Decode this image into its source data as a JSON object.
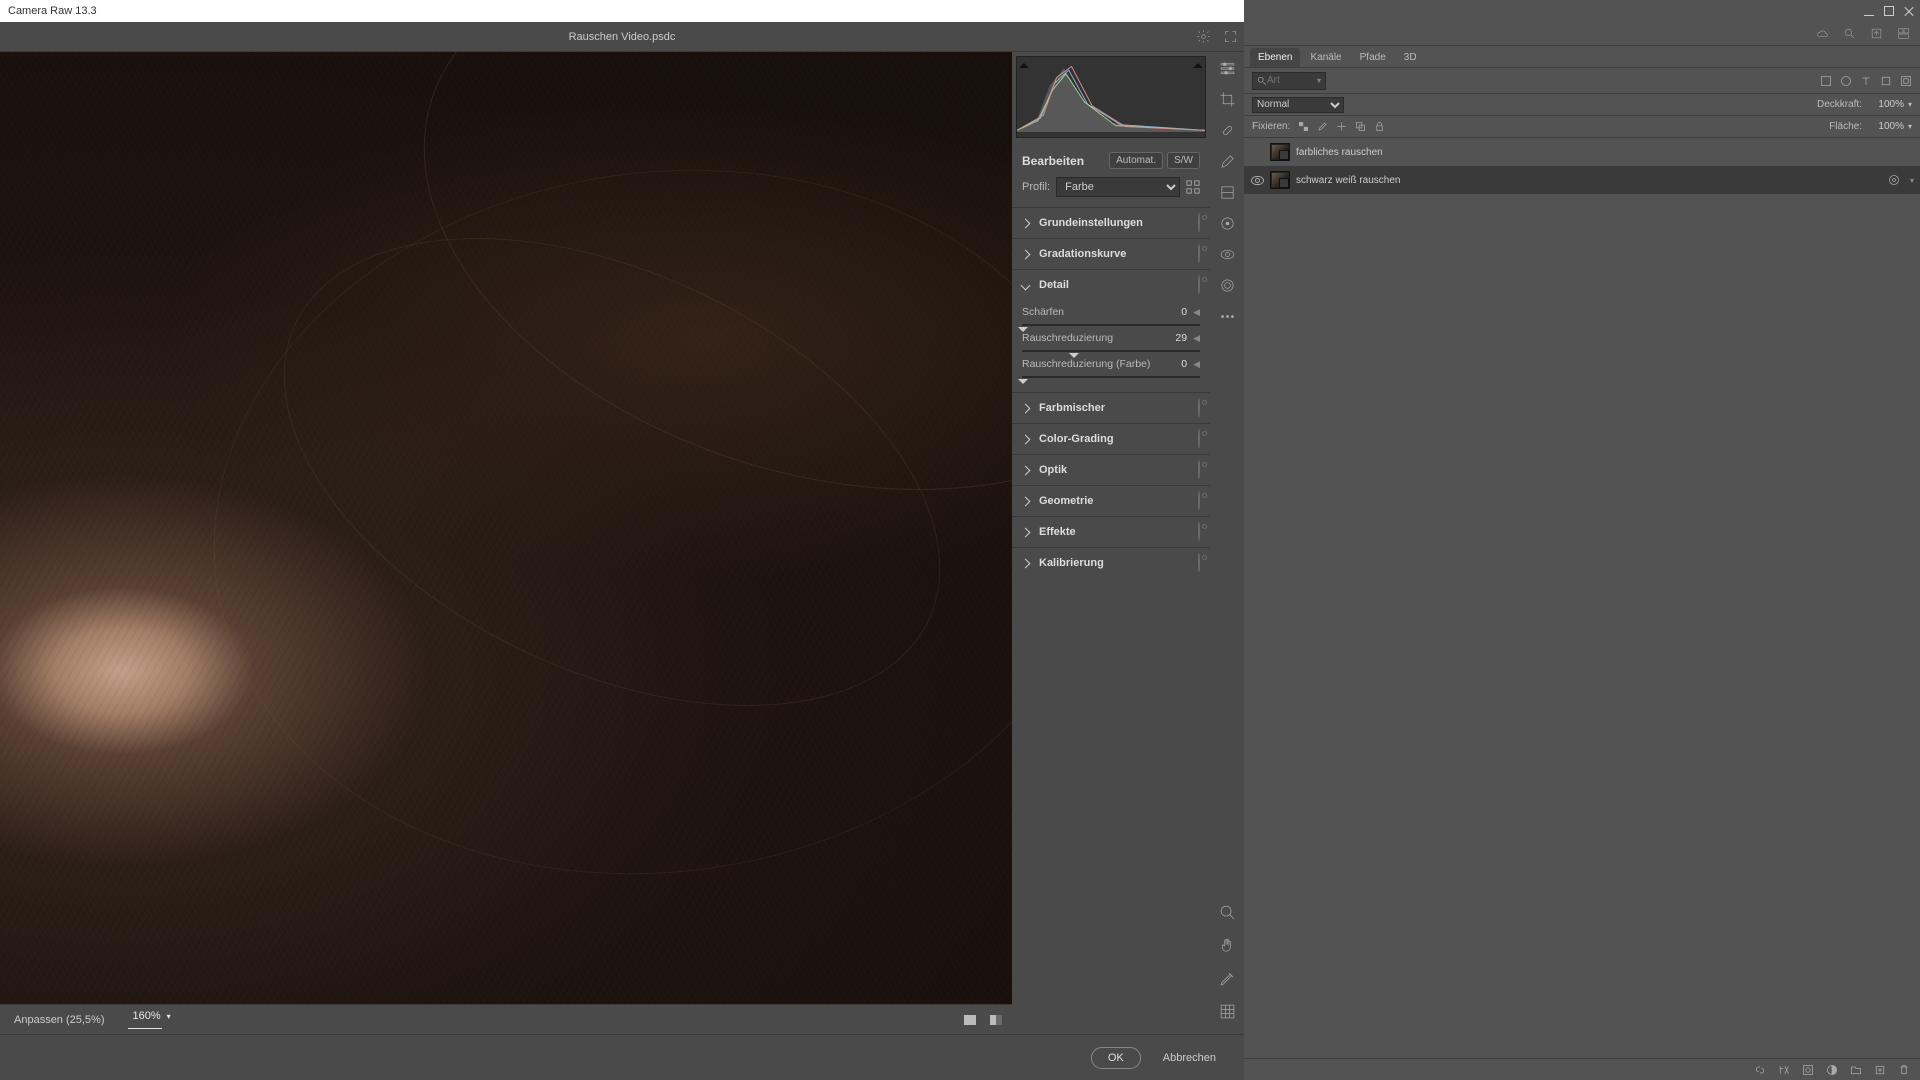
{
  "cr": {
    "title": "Camera Raw 13.3",
    "filename": "Rauschen Video.psdc",
    "fit_label": "Anpassen (25,5%)",
    "zoom": "160%",
    "edit_title": "Bearbeiten",
    "auto_btn": "Automat.",
    "bw_btn": "S/W",
    "profile_lbl": "Profil:",
    "profile_val": "Farbe",
    "sections": {
      "basic": "Grundeinstellungen",
      "curve": "Gradationskurve",
      "detail": "Detail",
      "colormixer": "Farbmischer",
      "colorgrading": "Color-Grading",
      "optics": "Optik",
      "geometry": "Geometrie",
      "effects": "Effekte",
      "calibration": "Kalibrierung"
    },
    "detail_sliders": {
      "sharpen_lbl": "Schärfen",
      "sharpen_val": "0",
      "nr_lbl": "Rauschreduzierung",
      "nr_val": "29",
      "nrcolor_lbl": "Rauschreduzierung (Farbe)",
      "nrcolor_val": "0"
    },
    "ok": "OK",
    "cancel": "Abbrechen"
  },
  "ps": {
    "tabs": {
      "layers": "Ebenen",
      "channels": "Kanäle",
      "paths": "Pfade",
      "threed": "3D"
    },
    "search_placeholder": "Art",
    "blend_mode": "Normal",
    "opacity_lbl": "Deckkraft:",
    "opacity_val": "100%",
    "lock_lbl": "Fixieren:",
    "fill_lbl": "Fläche:",
    "fill_val": "100%",
    "layers": {
      "color_noise": "farbliches rauschen",
      "bw_noise": "schwarz weiß rauschen"
    }
  }
}
